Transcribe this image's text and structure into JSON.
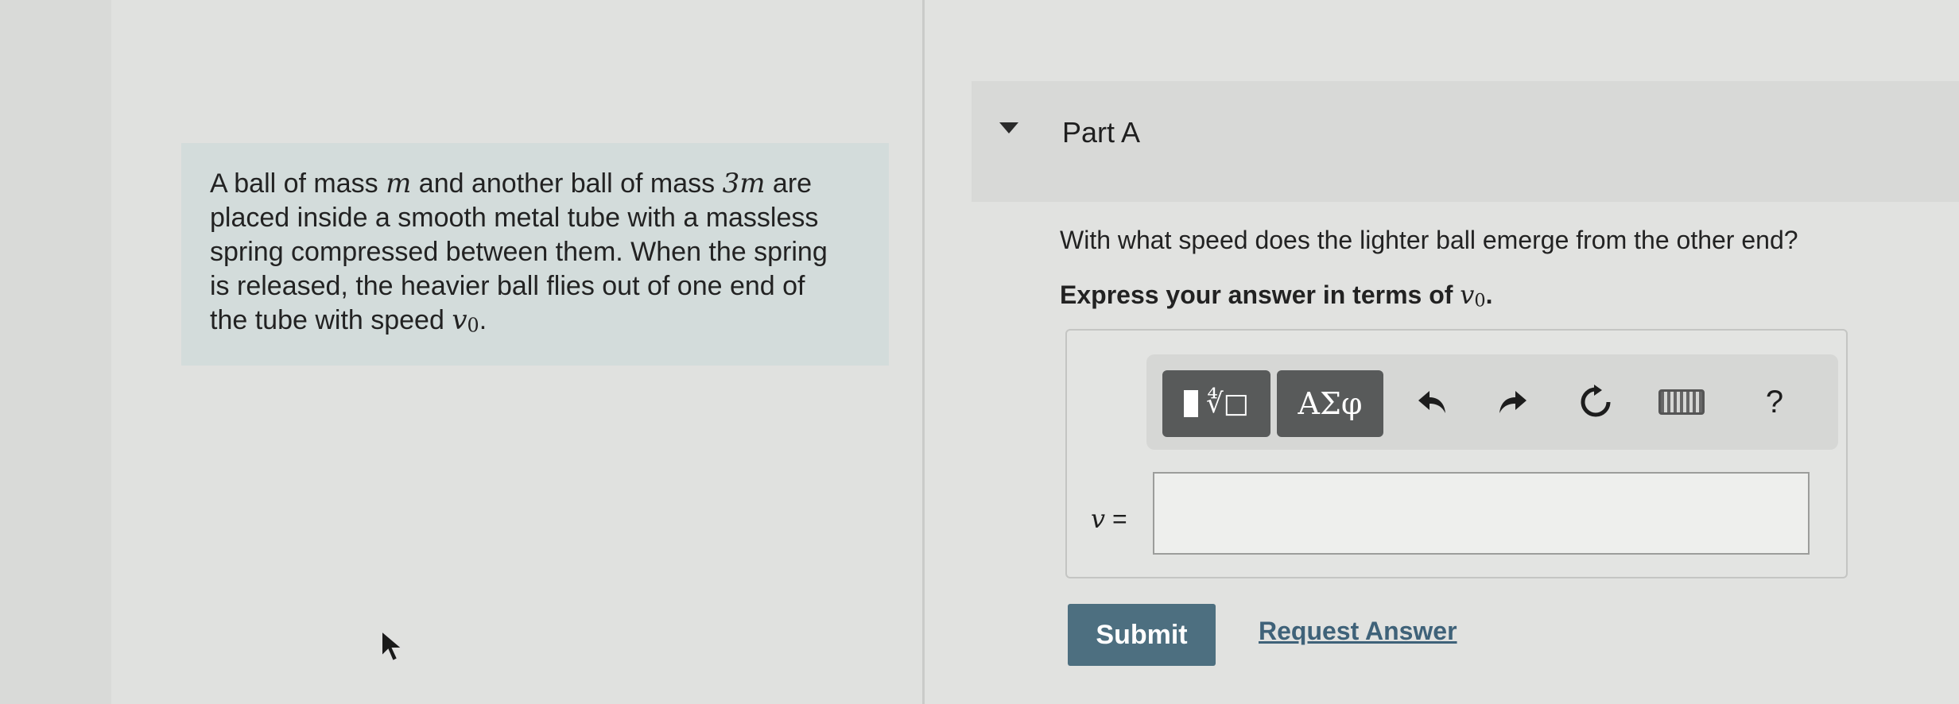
{
  "problem": {
    "line1_a": "A ball of mass ",
    "line1_m": "m",
    "line1_b": " and another ball of mass ",
    "line1_3m": "3m",
    "line1_c": " are",
    "line2": "placed inside a smooth metal tube with a massless",
    "line3": "spring compressed between them. When the spring",
    "line4": "is released, the heavier ball flies out of one end of",
    "line5_a": "the tube with speed ",
    "line5_v": "v",
    "line5_sub": "0",
    "line5_end": "."
  },
  "part": {
    "title": "Part A"
  },
  "question": {
    "text": "With what speed does the lighter ball emerge from the other end?",
    "instruction_a": "Express your answer in terms of ",
    "instruction_v": "v",
    "instruction_sub": "0",
    "instruction_end": "."
  },
  "toolbar": {
    "templates_glyph": "∜□",
    "greek_label": "ΑΣφ",
    "undo_icon": "undo-icon",
    "redo_icon": "redo-icon",
    "reset_icon": "reset-icon",
    "keyboard_icon": "keyboard-icon",
    "help_label": "?"
  },
  "answer": {
    "variable": "v",
    "equals": " =",
    "value": ""
  },
  "actions": {
    "submit_label": "Submit",
    "request_label": "Request Answer"
  }
}
